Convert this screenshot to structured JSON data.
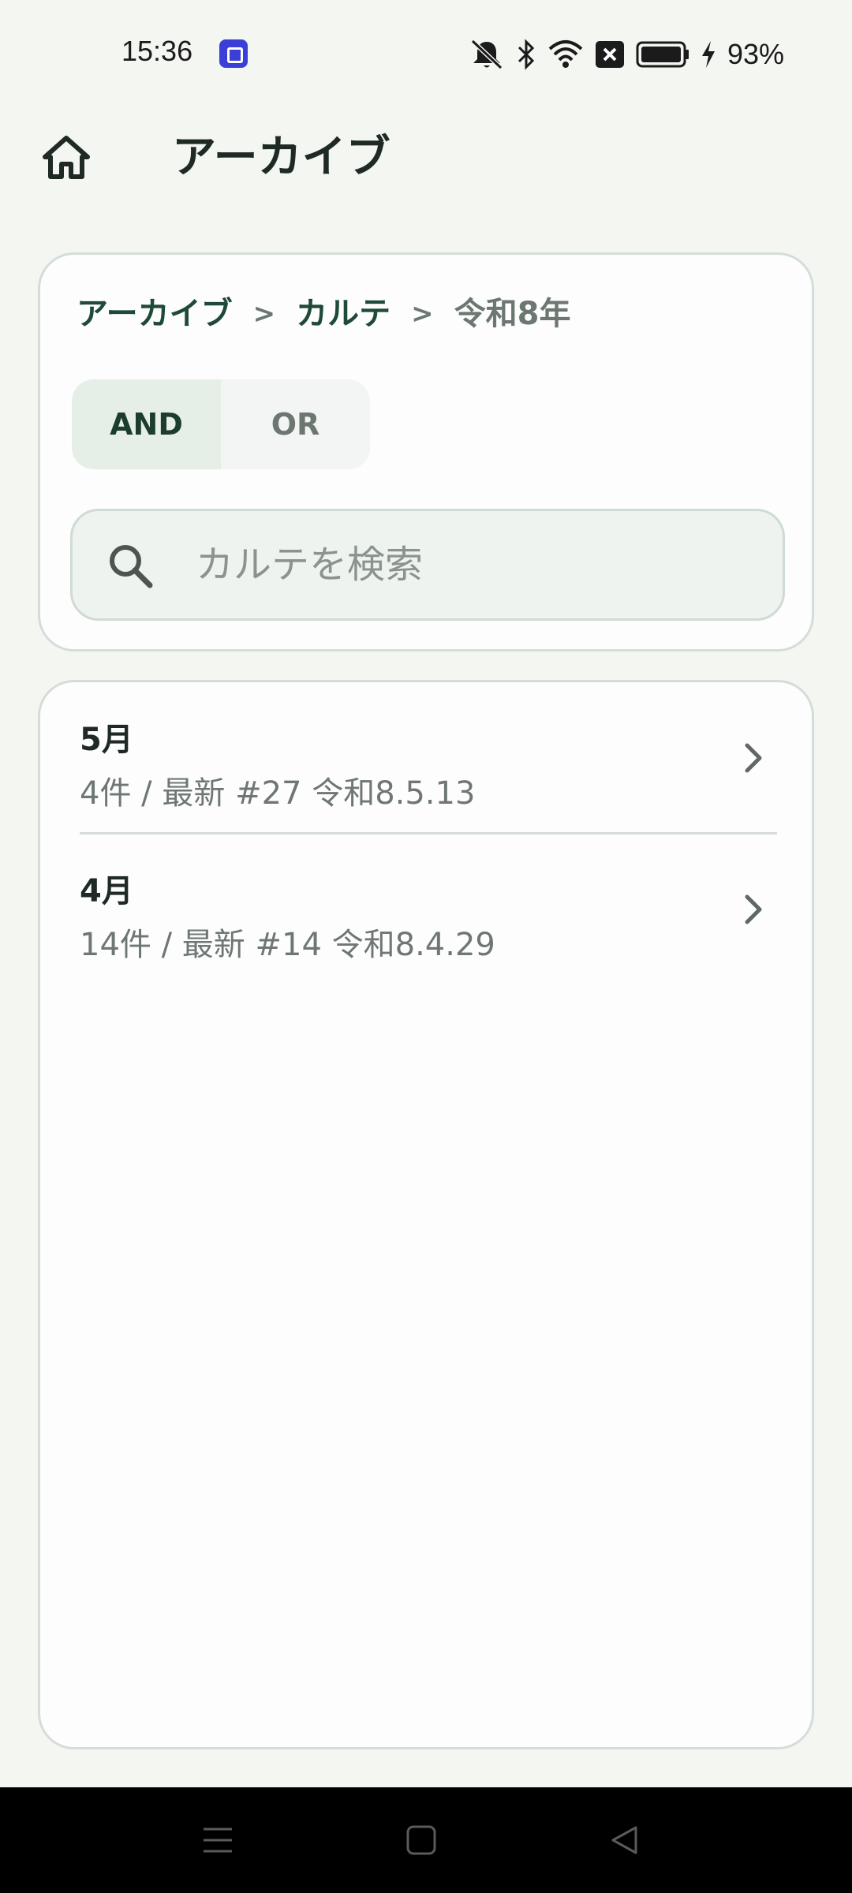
{
  "status_bar": {
    "time": "15:36",
    "battery_percent": "93%",
    "icons": [
      "app-notification-icon",
      "mute-icon",
      "bluetooth-icon",
      "wifi-icon",
      "sim-off-icon",
      "battery-icon",
      "charging-icon"
    ]
  },
  "header": {
    "home_icon": "home-icon",
    "title": "アーカイブ"
  },
  "breadcrumb": {
    "items": [
      "アーカイブ",
      "カルテ",
      "令和8年"
    ],
    "separator": ">"
  },
  "filter_mode": {
    "options": [
      "AND",
      "OR"
    ],
    "selected": "AND"
  },
  "search": {
    "placeholder": "カルテを検索",
    "value": ""
  },
  "months": [
    {
      "title": "5月",
      "subtitle": "4件 / 最新 #27 令和8.5.13"
    },
    {
      "title": "4月",
      "subtitle": "14件 / 最新 #14 令和8.4.29"
    }
  ],
  "colors": {
    "background": "#f4f6f2",
    "card": "#fdfdfd",
    "accent": "#1f4a37",
    "muted_text": "#6e7772"
  }
}
